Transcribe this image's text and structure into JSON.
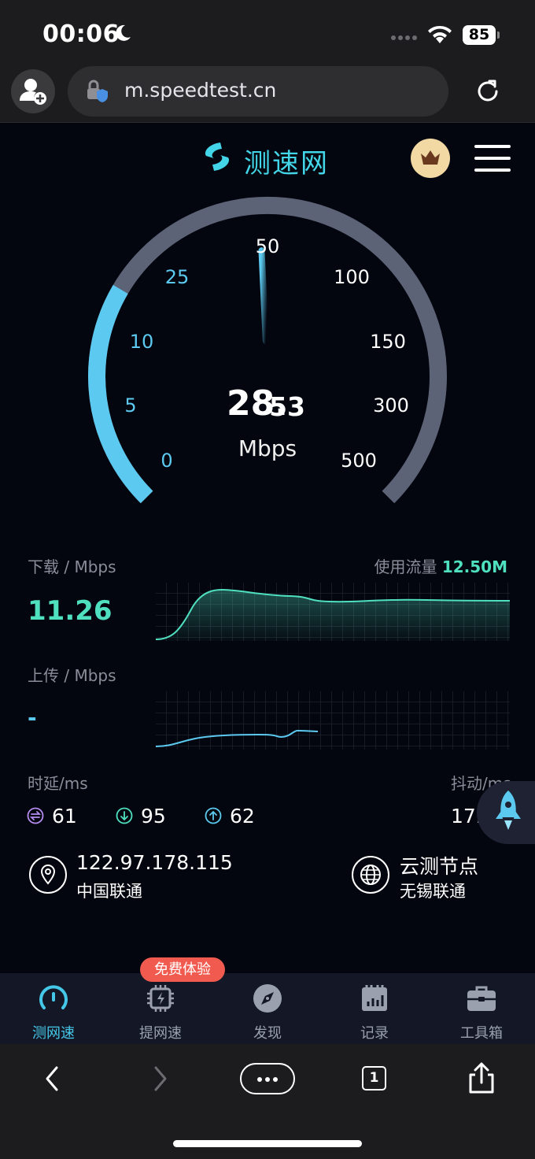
{
  "status_bar": {
    "time": "00:06",
    "battery": "85"
  },
  "browser": {
    "url": "m.speedtest.cn",
    "tab_count": "1"
  },
  "header": {
    "logo_text": "测速网"
  },
  "gauge": {
    "speed_int": "28.",
    "speed_dec": "53",
    "unit": "Mbps",
    "progress_fraction": 0.28,
    "ticks": [
      "0",
      "5",
      "10",
      "25",
      "50",
      "100",
      "150",
      "300",
      "500"
    ],
    "colors": {
      "done": "#5ccaf0",
      "track": "#5d6376"
    }
  },
  "download": {
    "label": "下载 / Mbps",
    "value": "11.26",
    "flow_label": "使用流量",
    "flow_value": "12.50M"
  },
  "upload": {
    "label": "上传 / Mbps",
    "value": "-"
  },
  "latency": {
    "label": "时延/ms",
    "idle": "61",
    "download": "95",
    "upload": "62",
    "jitter_label": "抖动/ms",
    "jitter_value": "17."
  },
  "ip_info": {
    "ip": "122.97.178.115",
    "isp": "中国联通"
  },
  "node_info": {
    "title": "云测节点",
    "name": "无锡联通"
  },
  "tab_bar": {
    "promo_badge": "免费体验",
    "tabs": [
      {
        "label": "测网速",
        "icon": "gauge-icon",
        "active": true
      },
      {
        "label": "提网速",
        "icon": "chip-icon",
        "active": false
      },
      {
        "label": "发现",
        "icon": "compass-icon",
        "active": false
      },
      {
        "label": "记录",
        "icon": "calendar-chart-icon",
        "active": false
      },
      {
        "label": "工具箱",
        "icon": "toolbox-icon",
        "active": false
      }
    ]
  },
  "colors": {
    "accent_cyan": "#45c8e8",
    "download_green": "#4fe0c0",
    "promo_red": "#f05a4f",
    "background": "#04060f"
  }
}
